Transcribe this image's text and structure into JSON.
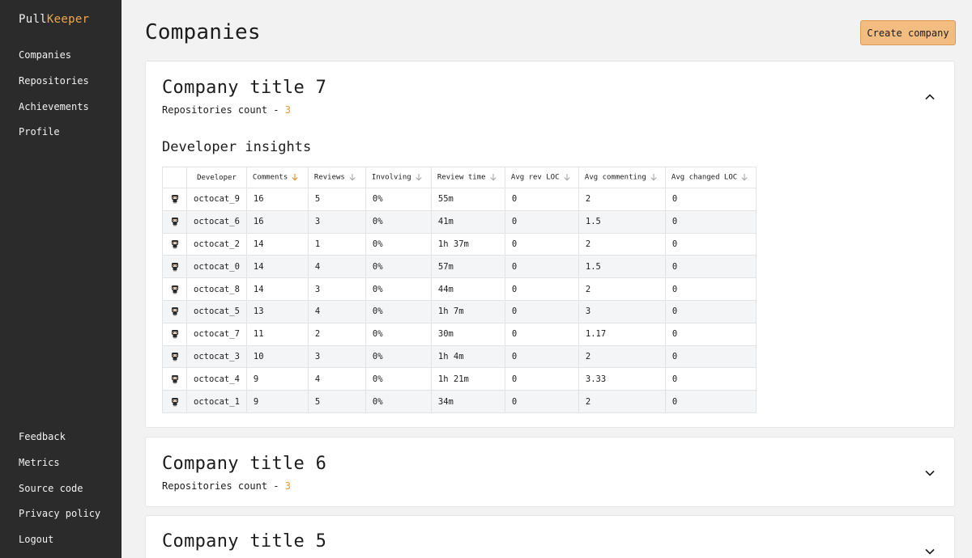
{
  "app": {
    "logo_part1": "Pull",
    "logo_part2": "Keeper"
  },
  "sidebar": {
    "top_items": [
      {
        "label": "Companies"
      },
      {
        "label": "Repositories"
      },
      {
        "label": "Achievements"
      },
      {
        "label": "Profile"
      }
    ],
    "bottom_items": [
      {
        "label": "Feedback"
      },
      {
        "label": "Metrics"
      },
      {
        "label": "Source code"
      },
      {
        "label": "Privacy policy"
      },
      {
        "label": "Logout"
      }
    ]
  },
  "header": {
    "title": "Companies",
    "create_label": "Create company"
  },
  "colors": {
    "accent": "#f0a850",
    "button": "#f3bc80",
    "sidebar_bg": "#2b2b2b"
  },
  "companies": [
    {
      "title": "Company title 7",
      "repos_label": "Repositories count - ",
      "repos_count": "3",
      "expanded": true
    },
    {
      "title": "Company title 6",
      "repos_label": "Repositories count - ",
      "repos_count": "3",
      "expanded": false
    },
    {
      "title": "Company title 5",
      "expanded": false
    }
  ],
  "insights": {
    "title": "Developer insights",
    "columns": [
      "Developer",
      "Comments",
      "Reviews",
      "Involving",
      "Review time",
      "Avg rev LOC",
      "Avg commenting",
      "Avg changed LOC"
    ],
    "active_sort_column": "Comments",
    "rows": [
      [
        "octocat_9",
        "16",
        "5",
        "0%",
        "55m",
        "0",
        "2",
        "0"
      ],
      [
        "octocat_6",
        "16",
        "3",
        "0%",
        "41m",
        "0",
        "1.5",
        "0"
      ],
      [
        "octocat_2",
        "14",
        "1",
        "0%",
        "1h 37m",
        "0",
        "2",
        "0"
      ],
      [
        "octocat_0",
        "14",
        "4",
        "0%",
        "57m",
        "0",
        "1.5",
        "0"
      ],
      [
        "octocat_8",
        "14",
        "3",
        "0%",
        "44m",
        "0",
        "2",
        "0"
      ],
      [
        "octocat_5",
        "13",
        "4",
        "0%",
        "1h 7m",
        "0",
        "3",
        "0"
      ],
      [
        "octocat_7",
        "11",
        "2",
        "0%",
        "30m",
        "0",
        "1.17",
        "0"
      ],
      [
        "octocat_3",
        "10",
        "3",
        "0%",
        "1h 4m",
        "0",
        "2",
        "0"
      ],
      [
        "octocat_4",
        "9",
        "4",
        "0%",
        "1h 21m",
        "0",
        "3.33",
        "0"
      ],
      [
        "octocat_1",
        "9",
        "5",
        "0%",
        "34m",
        "0",
        "2",
        "0"
      ]
    ]
  }
}
